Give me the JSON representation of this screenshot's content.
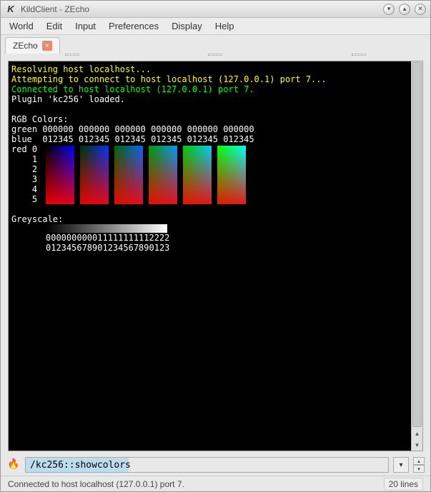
{
  "window": {
    "title": "KildClient - ZEcho"
  },
  "menubar": [
    "World",
    "Edit",
    "Input",
    "Preferences",
    "Display",
    "Help"
  ],
  "tabs": [
    {
      "label": "ZEcho"
    }
  ],
  "terminal": {
    "lines": [
      {
        "text": "Resolving host localhost...",
        "cls": "l-yellow"
      },
      {
        "text": "Attempting to connect to host localhost (127.0.0.1) port 7...",
        "cls": "l-yellow"
      },
      {
        "text": "Connected to host localhost (127.0.0.1) port 7.",
        "cls": "l-green"
      },
      {
        "text": "Plugin 'kc256' loaded.",
        "cls": ""
      },
      {
        "text": "",
        "cls": ""
      },
      {
        "text": "RGB Colors:",
        "cls": ""
      }
    ],
    "rgb_header": {
      "green_label": "green",
      "green_line": "000000 000000 000000 000000 000000 000000",
      "blue_label": "blue",
      "blue_line": "012345 012345 012345 012345 012345 012345"
    },
    "red_labels": [
      "red 0",
      "    1",
      "    2",
      "    3",
      "    4",
      "    5"
    ],
    "greyscale_label": "Greyscale:",
    "greyscale_idx1": "000000000011111111112222",
    "greyscale_idx2": "012345678901234567890123"
  },
  "input": {
    "value": "/kc256::showcolors",
    "placeholder": ""
  },
  "status": {
    "left": "Connected to host localhost (127.0.0.1) port 7.",
    "right": "20 lines"
  },
  "icons": {
    "minimize": "▾",
    "maximize": "▴",
    "close": "✕",
    "tabclose": "×",
    "fire": "🔥",
    "drop": "▾",
    "up": "▴",
    "down": "▾",
    "sup": "▴",
    "sdown": "▾"
  }
}
